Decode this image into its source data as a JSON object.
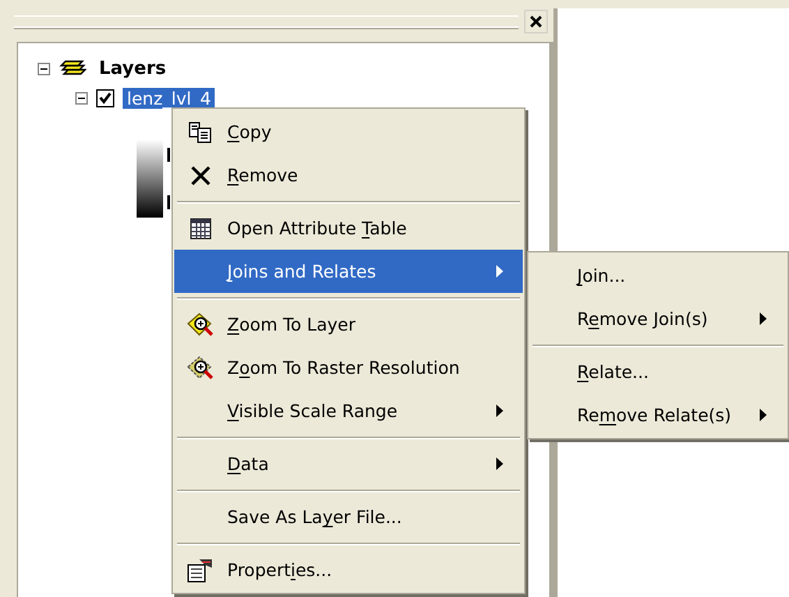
{
  "toc": {
    "tree": [
      {
        "label": "Layers",
        "expanded": true,
        "children": [
          {
            "label": "lenz_lvl_4",
            "expanded": true,
            "checked": true,
            "selected": true
          }
        ]
      }
    ]
  },
  "context_menu": {
    "items": [
      {
        "kind": "item",
        "label_parts": [
          {
            "text": "C",
            "underlined": true
          },
          {
            "text": "opy",
            "underlined": false
          }
        ],
        "has_submenu": false,
        "selected": false
      },
      {
        "kind": "item",
        "label_parts": [
          {
            "text": "R",
            "underlined": true
          },
          {
            "text": "emove",
            "underlined": false
          }
        ],
        "has_submenu": false,
        "selected": false
      },
      {
        "kind": "separator"
      },
      {
        "kind": "item",
        "label_parts": [
          {
            "text": "Open Attribute ",
            "underlined": false
          },
          {
            "text": "T",
            "underlined": true
          },
          {
            "text": "able",
            "underlined": false
          }
        ],
        "has_submenu": false,
        "selected": false
      },
      {
        "kind": "item",
        "label_parts": [
          {
            "text": "J",
            "underlined": true
          },
          {
            "text": "oins and Relates",
            "underlined": false
          }
        ],
        "has_submenu": true,
        "selected": true
      },
      {
        "kind": "separator"
      },
      {
        "kind": "item",
        "label_parts": [
          {
            "text": "Z",
            "underlined": true
          },
          {
            "text": "oom To Layer",
            "underlined": false
          }
        ],
        "has_submenu": false,
        "selected": false
      },
      {
        "kind": "item",
        "label_parts": [
          {
            "text": "Z",
            "underlined": false
          },
          {
            "text": "o",
            "underlined": true
          },
          {
            "text": "om To Raster Resolution",
            "underlined": false
          }
        ],
        "has_submenu": false,
        "selected": false
      },
      {
        "kind": "item",
        "label_parts": [
          {
            "text": "V",
            "underlined": true
          },
          {
            "text": "isible Scale Range",
            "underlined": false
          }
        ],
        "has_submenu": true,
        "selected": false
      },
      {
        "kind": "separator"
      },
      {
        "kind": "item",
        "label_parts": [
          {
            "text": "D",
            "underlined": true
          },
          {
            "text": "ata",
            "underlined": false
          }
        ],
        "has_submenu": true,
        "selected": false
      },
      {
        "kind": "separator"
      },
      {
        "kind": "item",
        "label_parts": [
          {
            "text": "Save As La",
            "underlined": false
          },
          {
            "text": "y",
            "underlined": true
          },
          {
            "text": "er File...",
            "underlined": false
          }
        ],
        "has_submenu": false,
        "selected": false
      },
      {
        "kind": "separator"
      },
      {
        "kind": "item",
        "label_parts": [
          {
            "text": "Propert",
            "underlined": false
          },
          {
            "text": "i",
            "underlined": true
          },
          {
            "text": "es...",
            "underlined": false
          }
        ],
        "has_submenu": false,
        "selected": false
      }
    ]
  },
  "submenu": {
    "items": [
      {
        "kind": "item",
        "label_parts": [
          {
            "text": "J",
            "underlined": true
          },
          {
            "text": "oin...",
            "underlined": false
          }
        ],
        "has_submenu": false,
        "selected": false
      },
      {
        "kind": "item",
        "label_parts": [
          {
            "text": "R",
            "underlined": false
          },
          {
            "text": "e",
            "underlined": true
          },
          {
            "text": "move Join(s)",
            "underlined": false
          }
        ],
        "has_submenu": true,
        "selected": false
      },
      {
        "kind": "separator"
      },
      {
        "kind": "item",
        "label_parts": [
          {
            "text": "R",
            "underlined": true
          },
          {
            "text": "elate...",
            "underlined": false
          }
        ],
        "has_submenu": false,
        "selected": false
      },
      {
        "kind": "item",
        "label_parts": [
          {
            "text": "Re",
            "underlined": false
          },
          {
            "text": "m",
            "underlined": true
          },
          {
            "text": "ove Relate(s)",
            "underlined": false
          }
        ],
        "has_submenu": true,
        "selected": false
      }
    ]
  }
}
